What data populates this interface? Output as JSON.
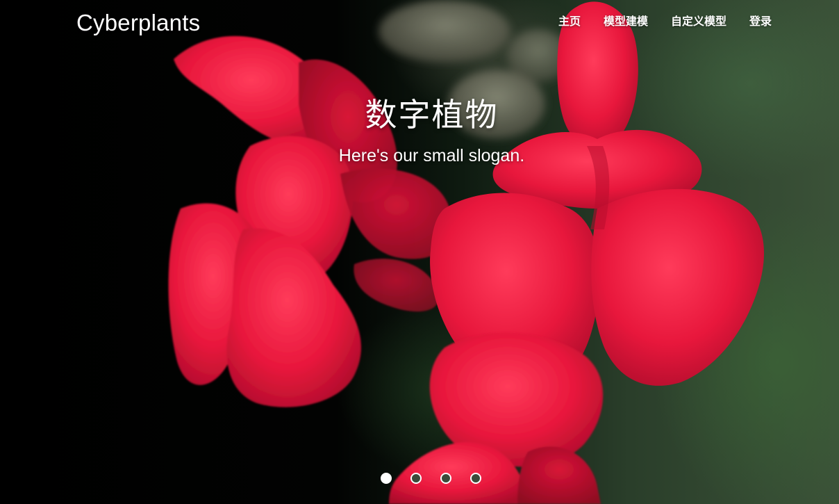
{
  "brand": {
    "name": "Cyberplants"
  },
  "nav": {
    "items": [
      {
        "label": "主页"
      },
      {
        "label": "模型建模"
      },
      {
        "label": "自定义模型"
      },
      {
        "label": "登录"
      }
    ]
  },
  "hero": {
    "title": "数字植物",
    "slogan": "Here's our small slogan."
  },
  "carousel": {
    "slide_count": 4,
    "active_index": 0
  },
  "colors": {
    "flower": "#e8173c",
    "background_dark": "#000000",
    "foliage": "#3b5238",
    "text": "#ffffff"
  }
}
